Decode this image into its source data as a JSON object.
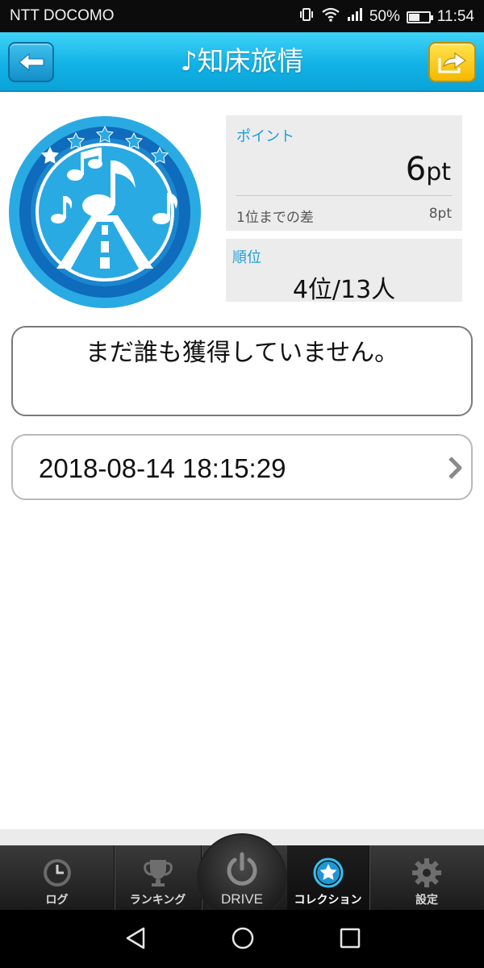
{
  "status_bar": {
    "carrier": "NTT DOCOMO",
    "battery": "50%",
    "time": "11:54",
    "battery_level": 0.5,
    "icons": [
      "vibrate-icon",
      "wifi-icon",
      "signal-icon",
      "battery-icon"
    ]
  },
  "header": {
    "title": "♪知床旅情",
    "back_icon": "arrow-left-icon",
    "share_icon": "share-arrow-icon",
    "colors": {
      "bar": "#12b2e6",
      "share": "#f5b800"
    }
  },
  "badge": {
    "icon": "music-road-badge-icon",
    "color": "#2aaae2"
  },
  "points": {
    "label": "ポイント",
    "value": "6",
    "unit": "pt",
    "diff_label": "1位までの差",
    "diff_value": "8pt"
  },
  "rank": {
    "label": "順位",
    "value": "4位/13人"
  },
  "message": "まだ誰も獲得していません。",
  "date_entry": {
    "datetime": "2018-08-14 18:15:29"
  },
  "tabs": [
    {
      "label": "ログ",
      "icon": "clock-icon"
    },
    {
      "label": "ランキング",
      "icon": "trophy-icon"
    },
    {
      "label": "DRIVE",
      "icon": "power-icon"
    },
    {
      "label": "コレクション",
      "icon": "star-icon",
      "active": true
    },
    {
      "label": "設定",
      "icon": "gear-icon"
    }
  ],
  "nav": [
    "back-triangle-icon",
    "home-circle-icon",
    "recents-square-icon"
  ]
}
